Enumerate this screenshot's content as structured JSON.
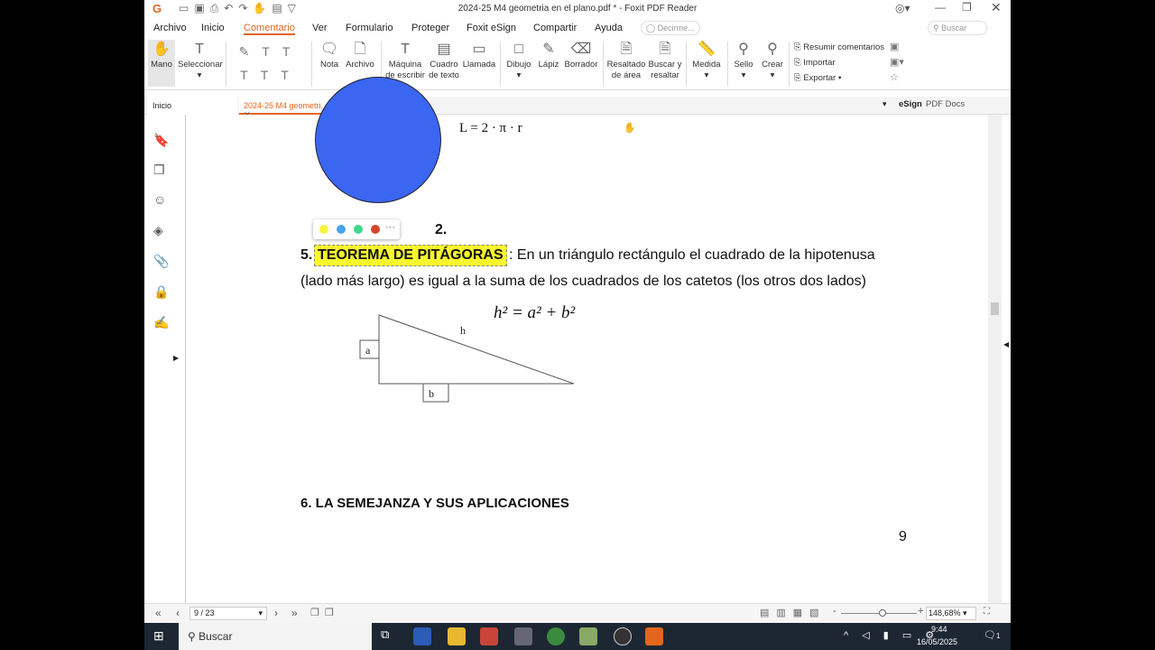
{
  "window": {
    "title": "2024-25 M4 geometria en el plano.pdf * - Foxit PDF Reader"
  },
  "menu": [
    "Archivo",
    "Inicio",
    "Comentario",
    "Ver",
    "Formulario",
    "Proteger",
    "Foxit eSign",
    "Compartir",
    "Ayuda"
  ],
  "tell_me": "Decirme...",
  "search_label": "Buscar",
  "ribbon": {
    "mano": "Mano",
    "seleccionar": "Seleccionar",
    "nota": "Nota",
    "archivo": "Archivo",
    "maquina1": "Máquina",
    "maquina2": "de escribir",
    "cuadro1": "Cuadro",
    "cuadro2": "de texto",
    "llamada": "Llamada",
    "dibujo": "Dibujo",
    "lapiz": "Lápiz",
    "borrador": "Borrador",
    "resaltado1": "Resaltado",
    "resaltado2": "de área",
    "buscar1": "Buscar y",
    "buscar2": "resaltar",
    "medida": "Medida",
    "sello": "Sello",
    "crear": "Crear",
    "resumir": "Resumir comentarios",
    "importar": "Importar",
    "exportar": "Exportar"
  },
  "tabs": {
    "home": "Inicio",
    "doc": "2024-25 M4 geometri...",
    "esign": "eSign",
    "pdfdocs": "PDF Docs"
  },
  "document": {
    "formula_circ": "L = 2 · π · r",
    "item2": "2.",
    "heading5_num": "5.",
    "heading5": "TEOREMA DE PITÁGORAS",
    "para1": ": En un triángulo rectángulo el cuadrado de la hipotenusa",
    "para2": "(lado más largo) es igual a la suma de los cuadrados de los catetos (los otros dos lados)",
    "formula_pyth": "h² = a² + b²",
    "label_h": "h",
    "label_a": "a",
    "label_b": "b",
    "heading6": "6. LA SEMEJANZA Y SUS APLICACIONES",
    "page_num": "9",
    "highlight_colors": [
      "#f5f53a",
      "#4aa3e8",
      "#3fd88a",
      "#d9452b"
    ]
  },
  "status": {
    "page": "9 / 23",
    "zoom": "148,68%",
    "zoom_fraction": 0.55
  },
  "taskbar": {
    "search": "Buscar",
    "time": "9:44",
    "date": "16/05/2025",
    "notifications": "1"
  }
}
